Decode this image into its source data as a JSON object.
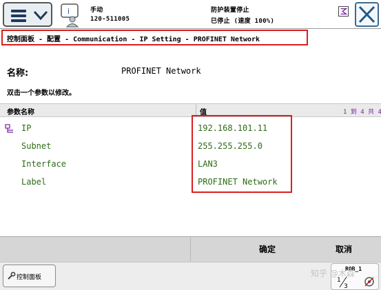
{
  "status": {
    "mode": "手动",
    "system_name": "120-511005",
    "safety": "防护装置停止",
    "motor_state": "已停止 (速度 100%)"
  },
  "breadcrumb": "控制面板 - 配置 - Communication - IP Setting - PROFINET Network",
  "instance": {
    "name_label": "名称:",
    "name_value": "PROFINET Network"
  },
  "hint": "双击一个参数以修改。",
  "table": {
    "col_name": "参数名称",
    "col_value": "值",
    "pagination": "1 到 4 共 4",
    "rows": [
      {
        "name": "IP",
        "value": "192.168.101.11"
      },
      {
        "name": "Subnet",
        "value": "255.255.255.0"
      },
      {
        "name": "Interface",
        "value": "LAN3"
      },
      {
        "name": "Label",
        "value": "PROFINET Network"
      }
    ]
  },
  "actions": {
    "ok": "确定",
    "cancel": "取消"
  },
  "taskbar": {
    "control_panel": "控制面板",
    "quickset_rob": "ROB_1",
    "quickset_fraction_top": "1",
    "quickset_fraction_bottom": "3"
  },
  "watermark": "知乎 @木森",
  "icons": {
    "menu": "hamburger-icon",
    "expand": "chevron-down-icon",
    "operator": "operator-window-icon",
    "close": "close-icon",
    "tree": "tree-node-icon",
    "control_panel": "wrench-icon",
    "quickset": "quickset-icon"
  },
  "colors": {
    "highlight": "#d81e1e",
    "param_text": "#2e6b16",
    "pagination": "#7a1fa0"
  }
}
